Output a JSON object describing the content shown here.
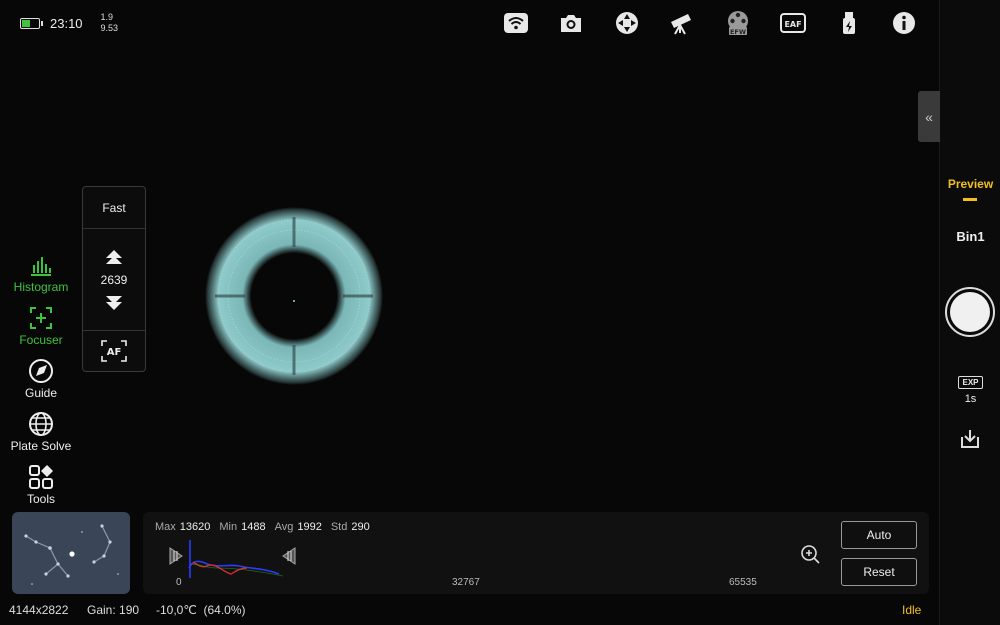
{
  "status": {
    "time": "23:10",
    "mini_top": "1.9",
    "mini_bottom": "9.53",
    "battery_level": 0.45
  },
  "top_icons": [
    "wifi-icon",
    "camera-icon",
    "mount-icon",
    "telescope-icon",
    "filter-wheel-icon",
    "eaf-icon",
    "usb-power-icon",
    "info-icon"
  ],
  "top_icon_labels": {
    "efw": "EFW",
    "eaf": "EAF"
  },
  "right_panel": {
    "tab_label": "Preview",
    "bin_label": "Bin1",
    "exp_badge": "EXP",
    "exp_value": "1s",
    "collapse_glyph": "«"
  },
  "left_tools": [
    {
      "label": "Histogram",
      "icon": "histogram-icon",
      "active": true
    },
    {
      "label": "Focuser",
      "icon": "focuser-icon",
      "active": true
    },
    {
      "label": "Guide",
      "icon": "guide-icon",
      "active": false
    },
    {
      "label": "Plate Solve",
      "icon": "globe-icon",
      "active": false
    },
    {
      "label": "Tools",
      "icon": "tools-icon",
      "active": false
    }
  ],
  "focuser": {
    "speed": "Fast",
    "position": "2639",
    "af_label": "AF"
  },
  "histogram": {
    "max_label": "Max",
    "max": "13620",
    "min_label": "Min",
    "min": "1488",
    "avg_label": "Avg",
    "avg": "1992",
    "std_label": "Std",
    "std": "290",
    "axis_start": "0",
    "axis_mid": "32767",
    "axis_end": "65535",
    "auto_label": "Auto",
    "reset_label": "Reset"
  },
  "bottom": {
    "resolution": "4144x2822",
    "gain": "Gain: 190",
    "temperature": "-10,0℃  (64.0%)",
    "state": "Idle"
  },
  "colors": {
    "accent": "#f0c020",
    "active_green": "#3ec33e",
    "star": "#8fd6d6"
  }
}
